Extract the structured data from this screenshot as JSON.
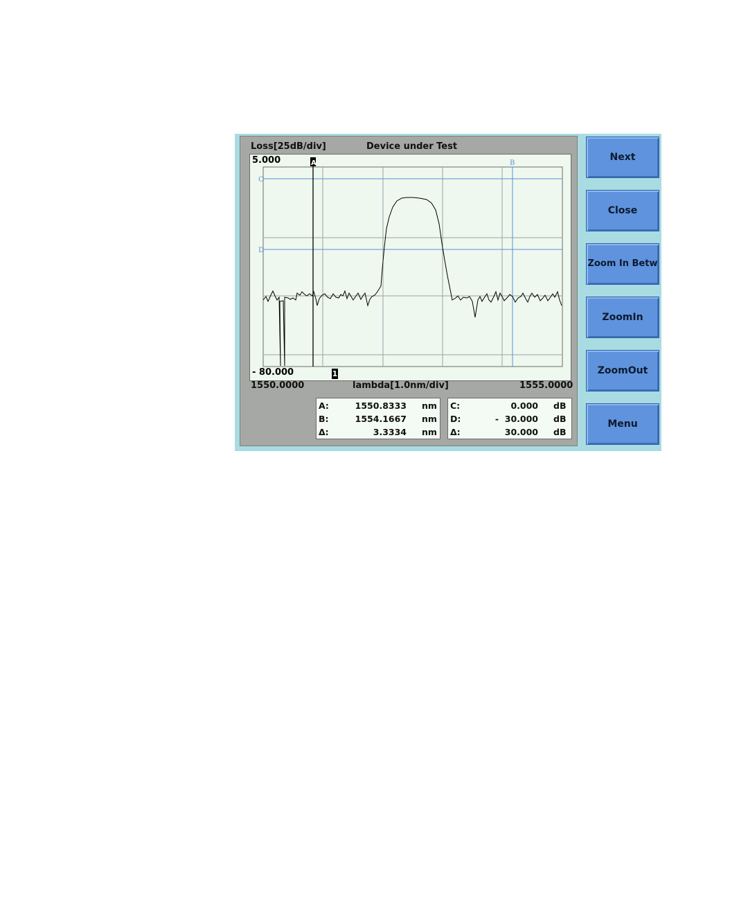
{
  "header": {
    "y_axis_label": "Loss[25dB/div]",
    "title": "Device under Test"
  },
  "plot": {
    "y_top_label": "5.000",
    "y_bottom_label": "- 80.000",
    "x_left_label": "1550.0000",
    "x_axis_label": "lambda[1.0nm/div]",
    "x_right_label": "1555.0000",
    "marker_labels": {
      "A": "A",
      "B": "B",
      "C": "C",
      "D": "D",
      "trace": "1"
    },
    "trace_color": "#000000",
    "cursor_color": "#5b8fd8",
    "grid_color": "#9aa2a6"
  },
  "readout_wavelength": {
    "rows": [
      {
        "key": "A:",
        "value": "1550.8333",
        "unit": "nm"
      },
      {
        "key": "B:",
        "value": "1554.1667",
        "unit": "nm"
      },
      {
        "key": "Δ:",
        "value": "3.3334",
        "unit": "nm"
      }
    ]
  },
  "readout_loss": {
    "rows": [
      {
        "key": "C:",
        "value": "0.000",
        "unit": "dB"
      },
      {
        "key": "D:",
        "value": "-  30.000",
        "unit": "dB"
      },
      {
        "key": "Δ:",
        "value": "30.000",
        "unit": "dB"
      }
    ]
  },
  "softkeys": {
    "next": "Next",
    "close": "Close",
    "zoom_in_between": "Zoom In Betw",
    "zoom_in": "ZoomIn",
    "zoom_out": "ZoomOut",
    "menu": "Menu"
  }
}
